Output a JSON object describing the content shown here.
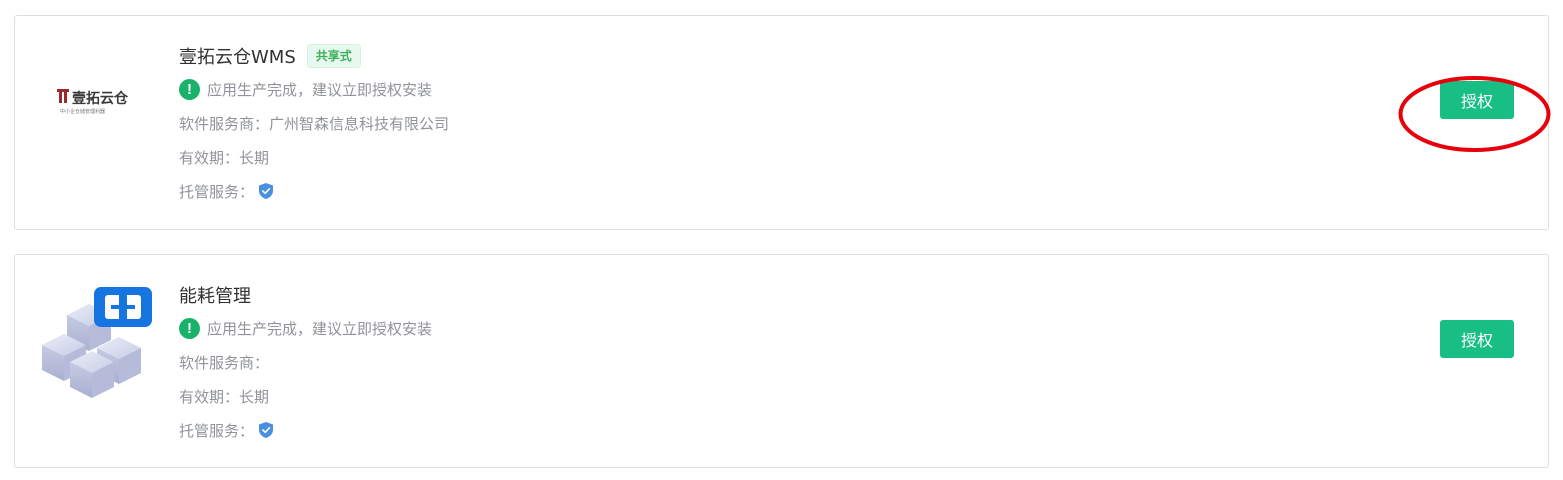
{
  "apps": [
    {
      "title": "壹拓云仓WMS",
      "tag": "共享式",
      "status": "应用生产完成，建议立即授权安装",
      "provider_label": "软件服务商：",
      "provider": "广州智森信息科技有限公司",
      "validity_label": "有效期：",
      "validity": "长期",
      "hosting_label": "托管服务：",
      "button": "授权",
      "logo_text": "壹拓云仓",
      "logo_subtext": "中小企仓储管理利器"
    },
    {
      "title": "能耗管理",
      "status": "应用生产完成，建议立即授权安装",
      "provider_label": "软件服务商：",
      "provider": "",
      "validity_label": "有效期：",
      "validity": "长期",
      "hosting_label": "托管服务：",
      "button": "授权"
    }
  ],
  "colors": {
    "primary_button": "#19be85",
    "status_icon": "#19b26b",
    "annotation": "#e8000b",
    "tag_text": "#3cb15c"
  },
  "icons": [
    "status-alert-icon",
    "shield-check-icon",
    "cube-logo"
  ]
}
